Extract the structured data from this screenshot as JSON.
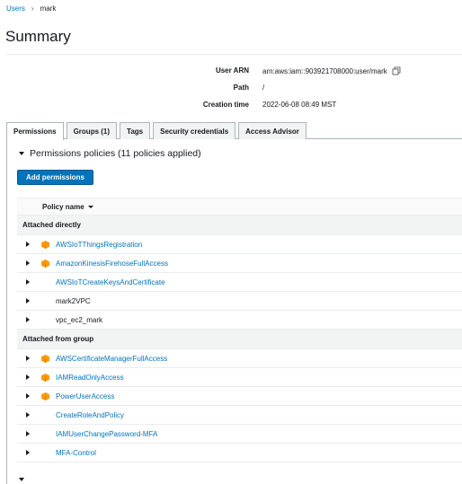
{
  "breadcrumb": {
    "root": "Users",
    "separator": "›",
    "current": "mark"
  },
  "page": {
    "title": "Summary"
  },
  "summary": [
    {
      "key": "User ARN",
      "value": "arn:aws:iam::903921708000:user/mark",
      "copy_icon": "copy-icon"
    },
    {
      "key": "Path",
      "value": "/"
    },
    {
      "key": "Creation time",
      "value": "2022-06-08 08:49 MST"
    }
  ],
  "tabs": [
    {
      "label": "Permissions",
      "active": true
    },
    {
      "label": "Groups (1)",
      "active": false
    },
    {
      "label": "Tags",
      "active": false
    },
    {
      "label": "Security credentials",
      "active": false
    },
    {
      "label": "Access Advisor",
      "active": false
    }
  ],
  "permissions": {
    "section_title": "Permissions policies (11 policies applied)",
    "add_button": "Add permissions",
    "column_header": "Policy name",
    "groups": [
      {
        "label": "Attached directly",
        "policies": [
          {
            "name": "AWSIoTThingsRegistration",
            "managed": true,
            "link": true
          },
          {
            "name": "AmazonKinesisFirehoseFullAccess",
            "managed": true,
            "link": true
          },
          {
            "name": "AWSIoTCreateKeysAndCertificate",
            "managed": false,
            "link": true
          },
          {
            "name": "mark2VPC",
            "managed": false,
            "link": false
          },
          {
            "name": "vpc_ec2_mark",
            "managed": false,
            "link": false
          }
        ]
      },
      {
        "label": "Attached from group",
        "policies": [
          {
            "name": "AWSCertificateManagerFullAccess",
            "managed": true,
            "link": true
          },
          {
            "name": "IAMReadOnlyAccess",
            "managed": true,
            "link": true
          },
          {
            "name": "PowerUserAccess",
            "managed": true,
            "link": true
          },
          {
            "name": "CreateRoleAndPolicy",
            "managed": false,
            "link": true
          },
          {
            "name": "IAMUserChangePassword-MFA",
            "managed": false,
            "link": true
          },
          {
            "name": "MFA-Control",
            "managed": false,
            "link": true
          }
        ]
      }
    ]
  },
  "colors": {
    "link": "#0073bb",
    "primary_button": "#0073bb",
    "aws_managed_icon": "#ff9900"
  }
}
